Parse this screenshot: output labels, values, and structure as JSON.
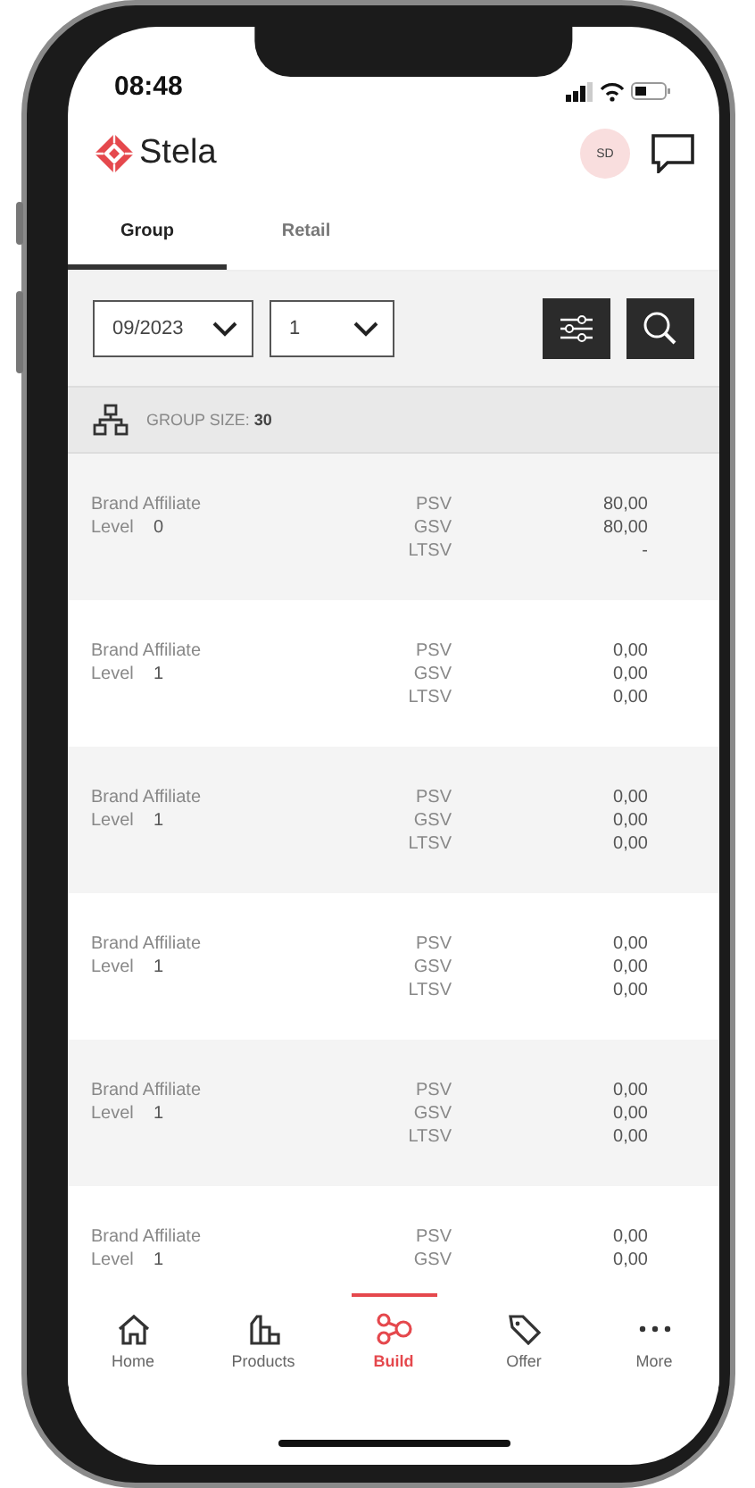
{
  "status_bar": {
    "time": "08:48"
  },
  "header": {
    "brand": "Stela",
    "avatar": "SD"
  },
  "tabs": [
    {
      "label": "Group",
      "selected": true
    },
    {
      "label": "Retail",
      "selected": false
    }
  ],
  "filters": {
    "period": "09/2023",
    "level": "1"
  },
  "group_size": {
    "label": "GROUP SIZE:",
    "value": "30"
  },
  "rows": [
    {
      "title": "Brand Affiliate",
      "level_label": "Level",
      "level": "0",
      "metrics": [
        {
          "name": "PSV",
          "value": "80,00"
        },
        {
          "name": "GSV",
          "value": "80,00"
        },
        {
          "name": "LTSV",
          "value": "-"
        }
      ]
    },
    {
      "title": "Brand Affiliate",
      "level_label": "Level",
      "level": "1",
      "metrics": [
        {
          "name": "PSV",
          "value": "0,00"
        },
        {
          "name": "GSV",
          "value": "0,00"
        },
        {
          "name": "LTSV",
          "value": "0,00"
        }
      ]
    },
    {
      "title": "Brand Affiliate",
      "level_label": "Level",
      "level": "1",
      "metrics": [
        {
          "name": "PSV",
          "value": "0,00"
        },
        {
          "name": "GSV",
          "value": "0,00"
        },
        {
          "name": "LTSV",
          "value": "0,00"
        }
      ]
    },
    {
      "title": "Brand Affiliate",
      "level_label": "Level",
      "level": "1",
      "metrics": [
        {
          "name": "PSV",
          "value": "0,00"
        },
        {
          "name": "GSV",
          "value": "0,00"
        },
        {
          "name": "LTSV",
          "value": "0,00"
        }
      ]
    },
    {
      "title": "Brand Affiliate",
      "level_label": "Level",
      "level": "1",
      "metrics": [
        {
          "name": "PSV",
          "value": "0,00"
        },
        {
          "name": "GSV",
          "value": "0,00"
        },
        {
          "name": "LTSV",
          "value": "0,00"
        }
      ]
    },
    {
      "title": "Brand Affiliate",
      "level_label": "Level",
      "level": "1",
      "metrics": [
        {
          "name": "PSV",
          "value": "0,00"
        },
        {
          "name": "GSV",
          "value": "0,00"
        }
      ]
    }
  ],
  "nav": [
    {
      "kind": "home",
      "label": "Home",
      "selected": false
    },
    {
      "kind": "products",
      "label": "Products",
      "selected": false
    },
    {
      "kind": "build",
      "label": "Build",
      "selected": true
    },
    {
      "kind": "offer",
      "label": "Offer",
      "selected": false
    },
    {
      "kind": "more",
      "label": "More",
      "selected": false
    }
  ]
}
